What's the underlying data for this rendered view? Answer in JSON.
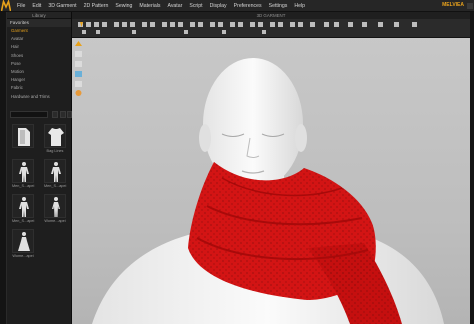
{
  "app": {
    "logo_name": "clo-logo-icon",
    "brand": "MELVIEA"
  },
  "menu": [
    "File",
    "Edit",
    "3D Garment",
    "2D Pattern",
    "Sewing",
    "Materials",
    "Avatar",
    "Script",
    "Display",
    "Preferences",
    "Settings",
    "Help"
  ],
  "library": {
    "title": "Library",
    "favorites_label": "Favorites",
    "items": [
      "Garment",
      "Avatar",
      "Hair",
      "Shoes",
      "Pose",
      "Motion",
      "Hanger",
      "Fabric",
      "Hardware and Trims"
    ],
    "active_index": 0,
    "thumbnails": [
      {
        "label": "",
        "icon": "folder-icon"
      },
      {
        "label": "Bag Lines",
        "icon": "garment-shirt-icon"
      },
      {
        "label": "Men_S...apei",
        "icon": "avatar-men-icon"
      },
      {
        "label": "Men_S...apei",
        "icon": "avatar-men-icon"
      },
      {
        "label": "Men_S...apei",
        "icon": "avatar-men-icon"
      },
      {
        "label": "Wome...apei",
        "icon": "avatar-women-icon"
      },
      {
        "label": "Wome...apei",
        "icon": "avatar-women-dress-icon"
      }
    ]
  },
  "viewport": {
    "title": "3D GARMENT",
    "garment_color": "#d31414",
    "background_color": "#c4c4c4"
  },
  "colors": {
    "accent": "#e8a21a",
    "panel": "#1e1e1e",
    "menubar": "#262626"
  }
}
